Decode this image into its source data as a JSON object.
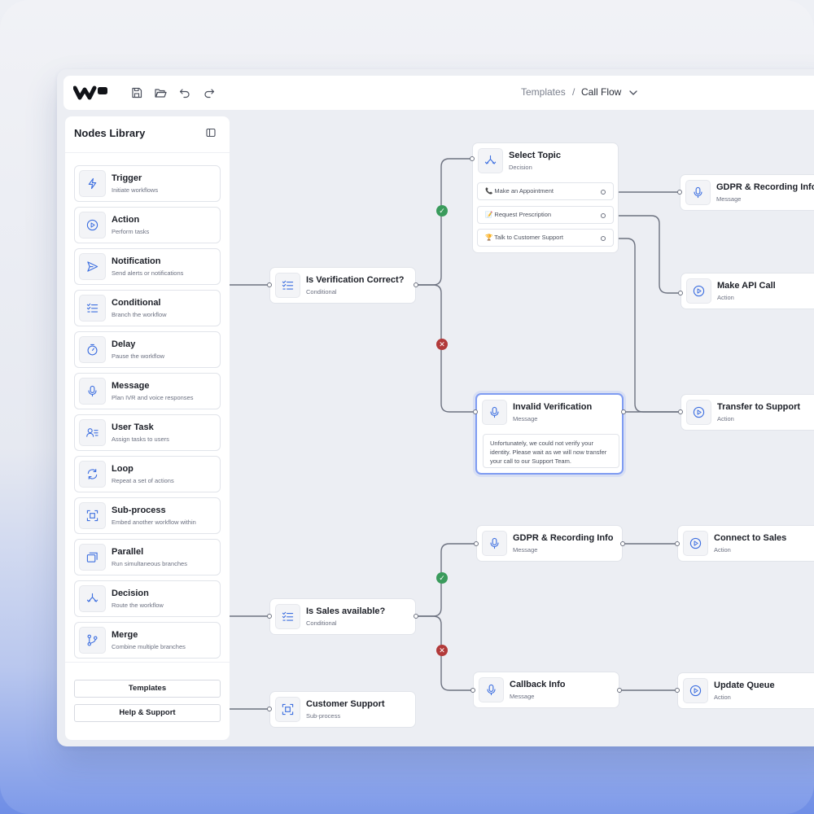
{
  "breadcrumb": {
    "parent": "Templates",
    "separator": "/",
    "current": "Call Flow"
  },
  "sidebar": {
    "title": "Nodes Library",
    "items": [
      {
        "label": "Trigger",
        "desc": "Initiate workflows",
        "icon": "bolt-icon"
      },
      {
        "label": "Action",
        "desc": "Perform tasks",
        "icon": "play-icon"
      },
      {
        "label": "Notification",
        "desc": "Send alerts or notifications",
        "icon": "send-icon"
      },
      {
        "label": "Conditional",
        "desc": "Branch the workflow",
        "icon": "checklist-icon"
      },
      {
        "label": "Delay",
        "desc": "Pause the workflow",
        "icon": "timer-icon"
      },
      {
        "label": "Message",
        "desc": "Plan IVR and voice responses",
        "icon": "microphone-icon"
      },
      {
        "label": "User Task",
        "desc": "Assign tasks to users",
        "icon": "user-list-icon"
      },
      {
        "label": "Loop",
        "desc": "Repeat a set of actions",
        "icon": "loop-icon"
      },
      {
        "label": "Sub-process",
        "desc": "Embed another workflow within",
        "icon": "frame-icon"
      },
      {
        "label": "Parallel",
        "desc": "Run simultaneous branches",
        "icon": "stack-icon"
      },
      {
        "label": "Decision",
        "desc": "Route the workflow",
        "icon": "split-icon"
      },
      {
        "label": "Merge",
        "desc": "Combine multiple branches",
        "icon": "merge-icon"
      }
    ],
    "buttons": {
      "templates": "Templates",
      "help": "Help & Support"
    }
  },
  "nodes": {
    "verification": {
      "title": "Is Verification Correct?",
      "sub": "Conditional"
    },
    "select_topic": {
      "title": "Select Topic",
      "sub": "Decision",
      "options": [
        "📞 Make an Appointment",
        "📝 Request Prescription",
        "🏆 Talk to Customer Support"
      ]
    },
    "gdpr_top": {
      "title": "GDPR & Recording Info",
      "sub": "Message"
    },
    "api_call": {
      "title": "Make API Call",
      "sub": "Action"
    },
    "invalid": {
      "title": "Invalid Verification",
      "sub": "Message",
      "message": "Unfortunately, we could not verify your identity. Please wait as we will now transfer your call to our Support Team."
    },
    "transfer": {
      "title": "Transfer to Support",
      "sub": "Action"
    },
    "gdpr_bottom": {
      "title": "GDPR & Recording Info",
      "sub": "Message"
    },
    "connect_sales": {
      "title": "Connect to Sales",
      "sub": "Action"
    },
    "sales": {
      "title": "Is Sales available?",
      "sub": "Conditional"
    },
    "callback": {
      "title": "Callback Info",
      "sub": "Message"
    },
    "update_queue": {
      "title": "Update Queue",
      "sub": "Action"
    },
    "customer_support": {
      "title": "Customer Support",
      "sub": "Sub-process"
    }
  },
  "badges": {
    "yes": "✓",
    "no": "✕"
  },
  "colors": {
    "accent": "#3d6fe0",
    "selected_border": "#7f9cf2",
    "success": "#3a9b5c",
    "danger": "#b23a3a"
  }
}
